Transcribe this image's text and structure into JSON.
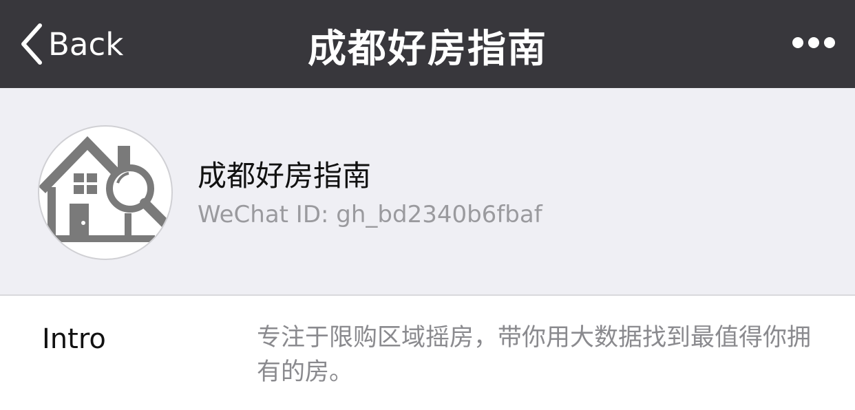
{
  "navbar": {
    "back_label": "Back",
    "title": "成都好房指南",
    "more_icon": "more-dots-icon",
    "background": "#38373c"
  },
  "profile": {
    "avatar_icon": "house-search-icon",
    "name": "成都好房指南",
    "wechat_id": "WeChat ID: gh_bd2340b6fbaf",
    "background": "#efeff4"
  },
  "intro": {
    "label": "Intro",
    "text": "专注于限购区域摇房，带你用大数据找到最值得你拥有的房。"
  }
}
